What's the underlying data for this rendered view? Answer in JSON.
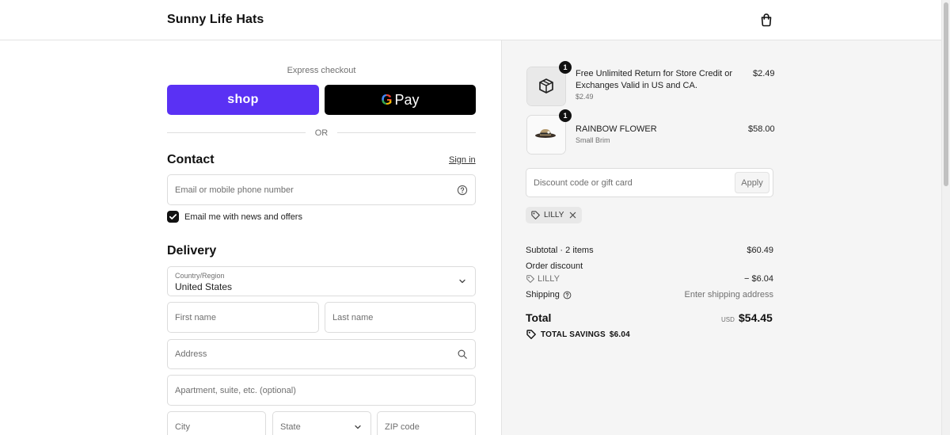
{
  "header": {
    "brand": "Sunny Life Hats"
  },
  "express": {
    "label": "Express checkout",
    "shop_label": "shop",
    "gpay_g": "G",
    "gpay_label": "Pay",
    "or_label": "OR"
  },
  "contact": {
    "title": "Contact",
    "signin": "Sign in",
    "email_placeholder": "Email or mobile phone number",
    "news_label": "Email me with news and offers",
    "news_checked": true
  },
  "delivery": {
    "title": "Delivery",
    "country_label": "Country/Region",
    "country_value": "United States",
    "first_name": "First name",
    "last_name": "Last name",
    "address": "Address",
    "apartment": "Apartment, suite, etc. (optional)",
    "city": "City",
    "state": "State",
    "zip": "ZIP code"
  },
  "cart": {
    "items": [
      {
        "qty": "1",
        "title_line1": "Free Unlimited Return for Store Credit or",
        "title_line2": "Exchanges Valid in US and CA.",
        "subtitle": "$2.49",
        "price": "$2.49",
        "icon": "return-package-icon"
      },
      {
        "qty": "1",
        "title_line1": "RAINBOW FLOWER",
        "title_line2": "",
        "subtitle": "Small Brim",
        "price": "$58.00",
        "icon": "hat-image"
      }
    ],
    "discount_placeholder": "Discount code or gift card",
    "apply_label": "Apply",
    "code_chip": "LILLY"
  },
  "summary": {
    "subtotal_label": "Subtotal · 2 items",
    "subtotal_value": "$60.49",
    "order_discount_label": "Order discount",
    "discount_code": "LILLY",
    "discount_value": "− $6.04",
    "shipping_label": "Shipping",
    "shipping_value": "Enter shipping address",
    "total_label": "Total",
    "currency": "USD",
    "total_value": "$54.45",
    "savings_label": "TOTAL SAVINGS",
    "savings_value": "$6.04"
  },
  "colors": {
    "shop_purple": "#5a31f4",
    "gpay_black": "#000000",
    "panel_bg": "#f5f5f5"
  }
}
